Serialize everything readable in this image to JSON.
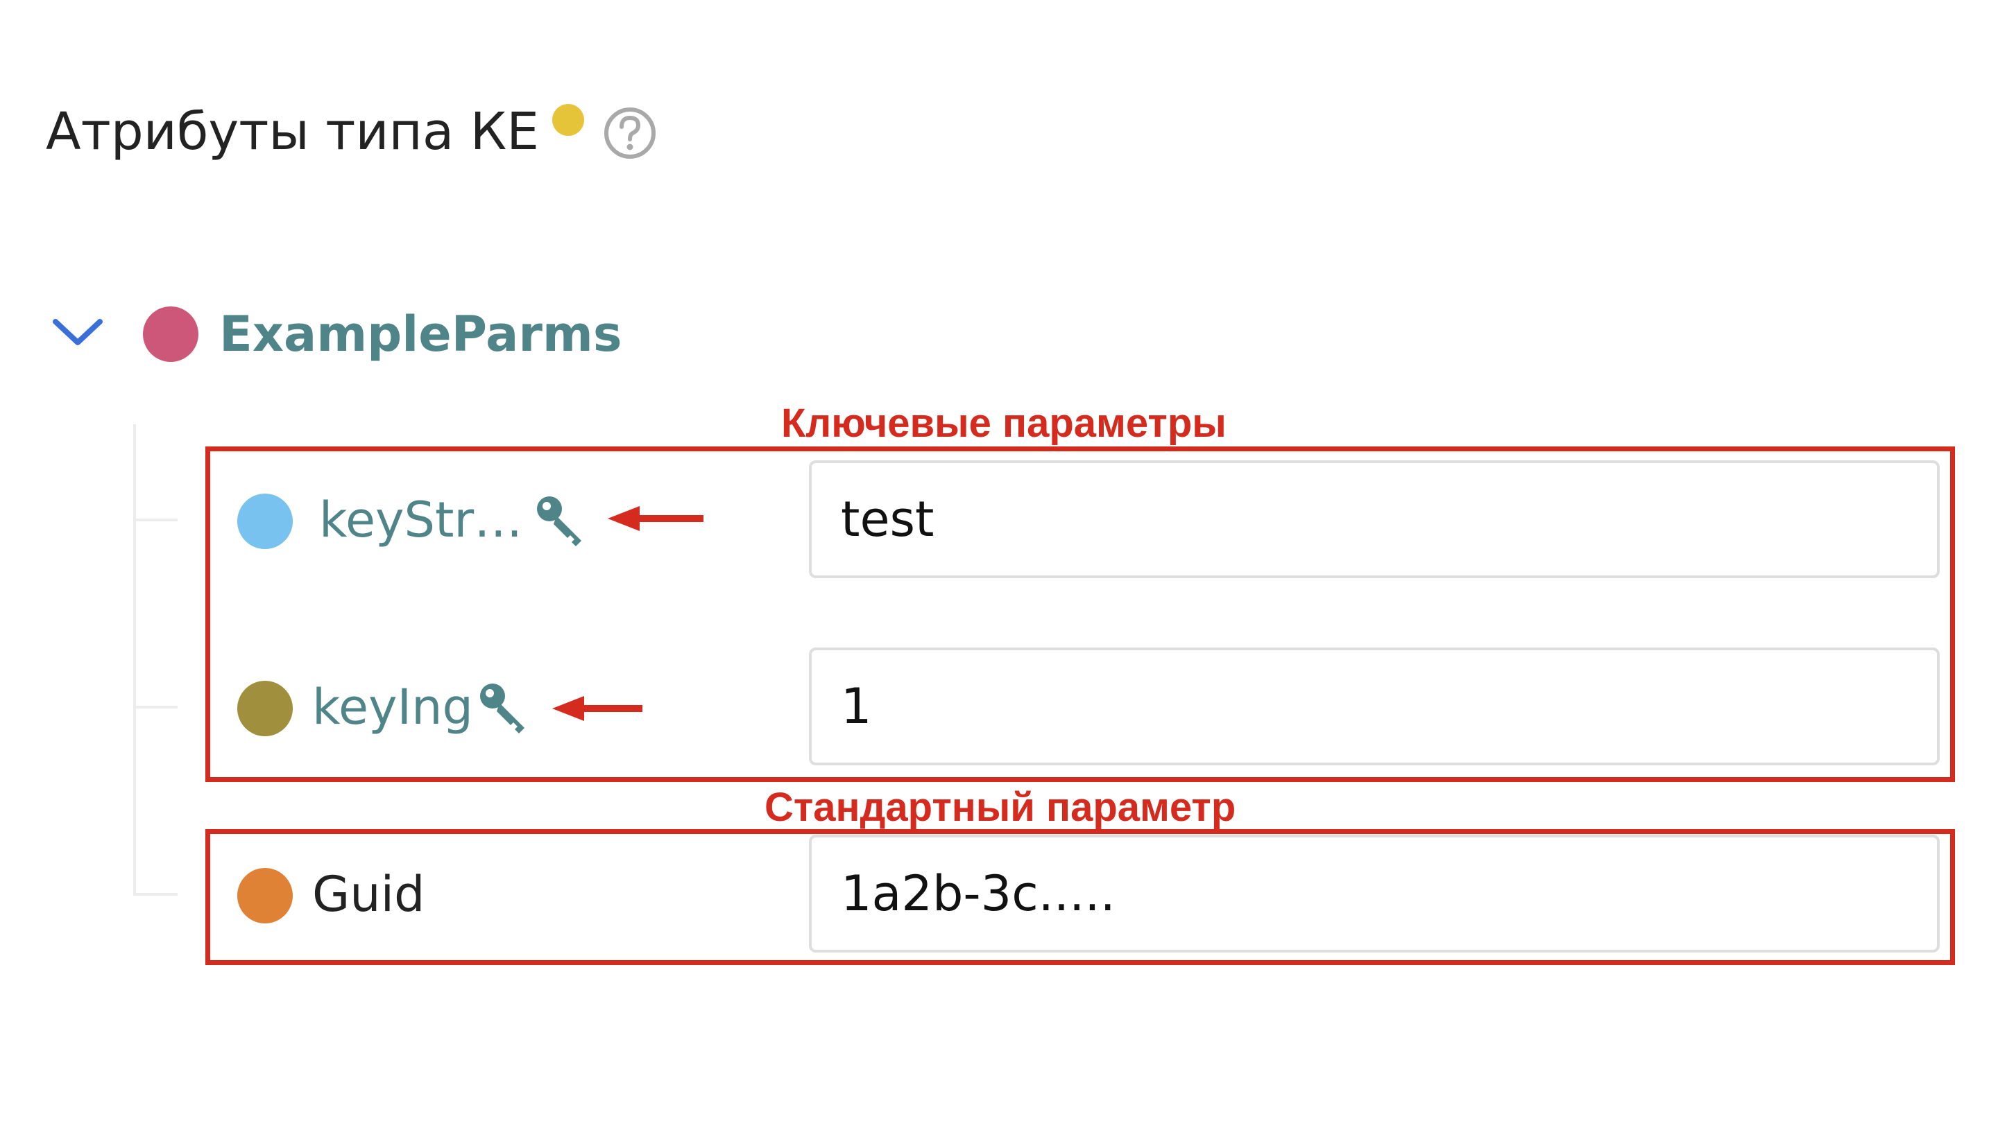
{
  "header": {
    "title": "Атрибуты типа КЕ",
    "status_dot_color": "#e6c43a",
    "help_icon": "question-circle-icon"
  },
  "group": {
    "name": "ExampleParms",
    "dot_color": "#cc5778",
    "label_color": "#4f8488",
    "expand_icon": "chevron-down-icon",
    "icon_color": "#3a6fd8"
  },
  "attributes": [
    {
      "label": "keyStr…",
      "value": "test",
      "dot_color": "#77c2ee",
      "label_color": "#4f8488",
      "is_key": true
    },
    {
      "label": "keyIng",
      "value": "1",
      "dot_color": "#a08f3c",
      "label_color": "#4f8488",
      "is_key": true
    },
    {
      "label": "Guid",
      "value": "1a2b-3c.....",
      "dot_color": "#e08236",
      "label_color": "#222222",
      "is_key": false
    }
  ],
  "annotations": {
    "color": "#d52b1e",
    "key_params_label": "Ключевые параметры",
    "standard_param_label": "Стандартный параметр",
    "key_icon": "key-icon",
    "key_icon_color": "#4f8488",
    "arrow_icon": "arrow-left-icon"
  }
}
